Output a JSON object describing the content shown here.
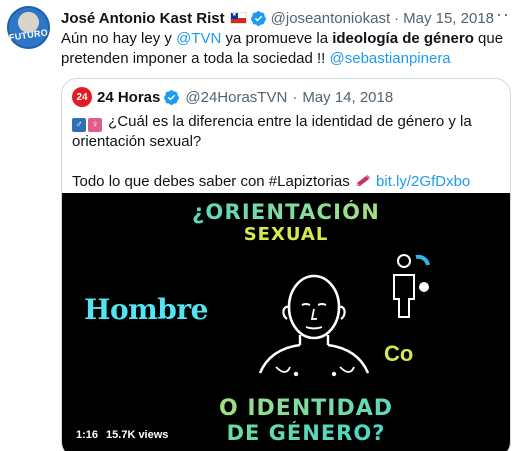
{
  "author": {
    "name": "José Antonio Kast Rist",
    "handle": "@joseantoniokast",
    "date": "May 15, 2018",
    "avatar_text": "FUTURO"
  },
  "more_label": "···",
  "tweet": {
    "part1": "Aún no hay ley y ",
    "mention1": "@TVN",
    "part2": " ya promueve la ",
    "bold": "ideología de género",
    "part3": " que pretenden imponer a toda la sociedad !! ",
    "mention2": "@sebastianpinera"
  },
  "quoted": {
    "avatar_text": "24",
    "name": "24 Horas",
    "handle": "@24HorasTVN",
    "date": "May 14, 2018",
    "line1": "¿Cuál es la diferencia entre la identidad de género y la orientación sexual?",
    "line2_text": "Todo lo que debes saber con #Lapiztorias",
    "line2_link": "bit.ly/2GfDxbo"
  },
  "media": {
    "title1": "¿ORIENTACIÓN",
    "title2": "SEXUAL",
    "hombre": "Hombre",
    "co": "Co",
    "bottom1": "O IDENTIDAD",
    "bottom2": "DE GÉNERO?",
    "duration": "1:16",
    "views": "15.7K views"
  },
  "colors": {
    "link": "#1d9bf0",
    "verified": "#1d9bf0",
    "border": "#cfd9de",
    "muted": "#536471"
  }
}
